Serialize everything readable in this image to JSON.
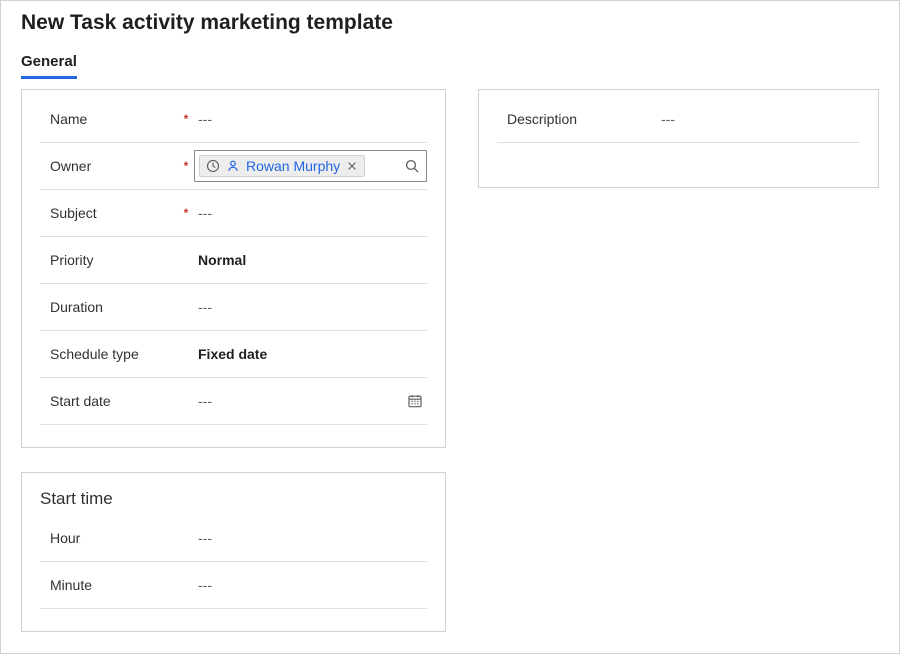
{
  "header": {
    "title": "New Task activity marketing template"
  },
  "tabs": [
    {
      "label": "General",
      "active": true
    }
  ],
  "empty": "---",
  "leftCard": {
    "rows": {
      "name": {
        "label": "Name",
        "required": true,
        "value": "---",
        "bold": false
      },
      "owner": {
        "label": "Owner",
        "required": true,
        "pill": "Rowan Murphy"
      },
      "subject": {
        "label": "Subject",
        "required": true,
        "value": "---",
        "bold": false
      },
      "priority": {
        "label": "Priority",
        "required": false,
        "value": "Normal",
        "bold": true
      },
      "duration": {
        "label": "Duration",
        "required": false,
        "value": "---",
        "bold": false
      },
      "scheduleType": {
        "label": "Schedule type",
        "required": false,
        "value": "Fixed date",
        "bold": true
      },
      "startDate": {
        "label": "Start date",
        "required": false,
        "value": "---",
        "bold": false,
        "hasCalendar": true
      }
    }
  },
  "startTimeCard": {
    "title": "Start time",
    "rows": {
      "hour": {
        "label": "Hour",
        "value": "---"
      },
      "minute": {
        "label": "Minute",
        "value": "---"
      }
    }
  },
  "rightCard": {
    "rows": {
      "description": {
        "label": "Description",
        "value": "---"
      }
    }
  },
  "icons": {
    "clock": "clock-icon",
    "person": "person-icon",
    "close": "close-icon",
    "search": "search-icon",
    "calendar": "calendar-icon"
  }
}
